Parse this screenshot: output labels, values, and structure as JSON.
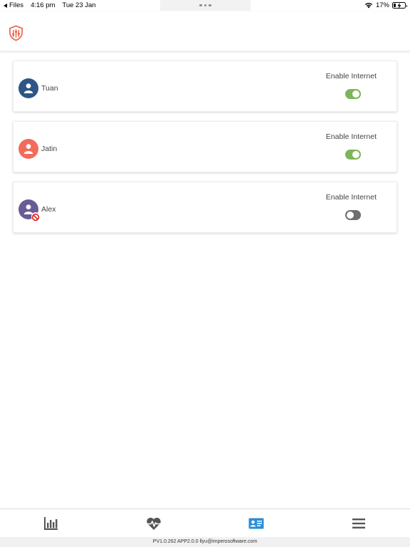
{
  "status_bar": {
    "back_label": "Files",
    "time": "4:16 pm",
    "date": "Tue 23 Jan",
    "battery_percent": "17%",
    "battery_level": 0.17
  },
  "header": {
    "logo_icon": "shield-logo-icon",
    "logo_color": "#e8674f"
  },
  "users": [
    {
      "name": "Tuan",
      "avatar_color": "#2e5585",
      "internet_label": "Enable Internet",
      "internet_enabled": true,
      "blocked": false
    },
    {
      "name": "Jatin",
      "avatar_color": "#f26b5b",
      "internet_label": "Enable Internet",
      "internet_enabled": true,
      "blocked": false
    },
    {
      "name": "Alex",
      "avatar_color": "#6b5b95",
      "internet_label": "Enable Internet",
      "internet_enabled": false,
      "blocked": true
    }
  ],
  "bottom_nav": {
    "items": [
      {
        "icon": "bar-chart-icon",
        "active": false
      },
      {
        "icon": "heartbeat-icon",
        "active": false
      },
      {
        "icon": "contact-card-icon",
        "active": true
      },
      {
        "icon": "menu-icon",
        "active": false
      }
    ],
    "active_color": "#2a8ed6",
    "inactive_color": "#555555"
  },
  "footer": {
    "text": "PV1.0.262 APP2.0.0 llyu@imperosoftware.com"
  },
  "colors": {
    "toggle_on": "#7eb45a",
    "toggle_off": "#6e6e6e",
    "blocked_badge": "#e0201c"
  }
}
